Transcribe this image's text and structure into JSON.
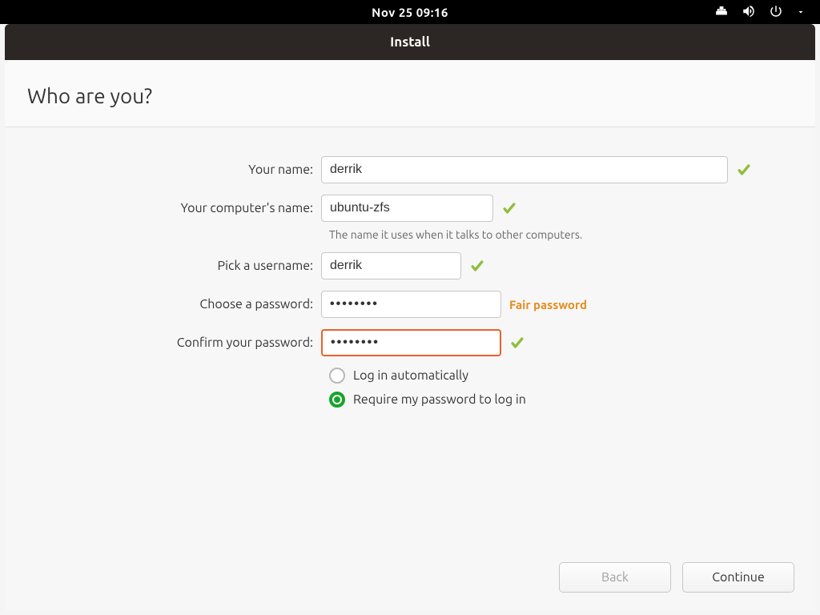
{
  "topbar": {
    "datetime": "Nov 25  09:16"
  },
  "titlebar": {
    "title": "Install"
  },
  "header": {
    "title": "Who are you?"
  },
  "form": {
    "name_label": "Your name:",
    "name_value": "derrik",
    "computer_label": "Your computer's name:",
    "computer_value": "ubuntu-zfs",
    "computer_hint": "The name it uses when it talks to other computers.",
    "username_label": "Pick a username:",
    "username_value": "derrik",
    "password_label": "Choose a password:",
    "password_value": "••••••••",
    "password_strength": "Fair password",
    "confirm_label": "Confirm your password:",
    "confirm_value": "••••••••",
    "radio_auto": "Log in automatically",
    "radio_require": "Require my password to log in",
    "radio_selected": "require"
  },
  "footer": {
    "back": "Back",
    "continue": "Continue"
  }
}
